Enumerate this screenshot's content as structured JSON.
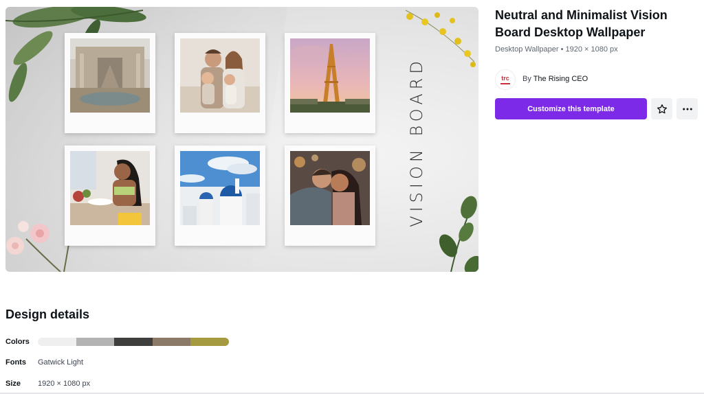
{
  "template": {
    "title": "Neutral and Minimalist Vision Board Desktop Wallpaper",
    "subtitle": "Desktop Wallpaper • 1920 × 1080 px",
    "author_prefix": "By",
    "author_name": "The Rising CEO",
    "author_logo_text": "trc",
    "customize_label": "Customize this template"
  },
  "preview": {
    "vision_text": "VISION BOARD",
    "photos": [
      {
        "name": "fountain-photo"
      },
      {
        "name": "family-photo"
      },
      {
        "name": "eiffel-tower-photo"
      },
      {
        "name": "woman-cooking-photo"
      },
      {
        "name": "santorini-photo"
      },
      {
        "name": "couple-photo"
      }
    ]
  },
  "details": {
    "heading": "Design details",
    "colors_label": "Colors",
    "colors": [
      "#efefef",
      "#b3b3b3",
      "#3e3e3c",
      "#8c7a68",
      "#a69a40"
    ],
    "fonts_label": "Fonts",
    "fonts_value": "Gatwick Light",
    "size_label": "Size",
    "size_value": "1920 × 1080 px"
  },
  "icons": {
    "favorite": "star-icon",
    "more": "more-horizontal-icon"
  }
}
